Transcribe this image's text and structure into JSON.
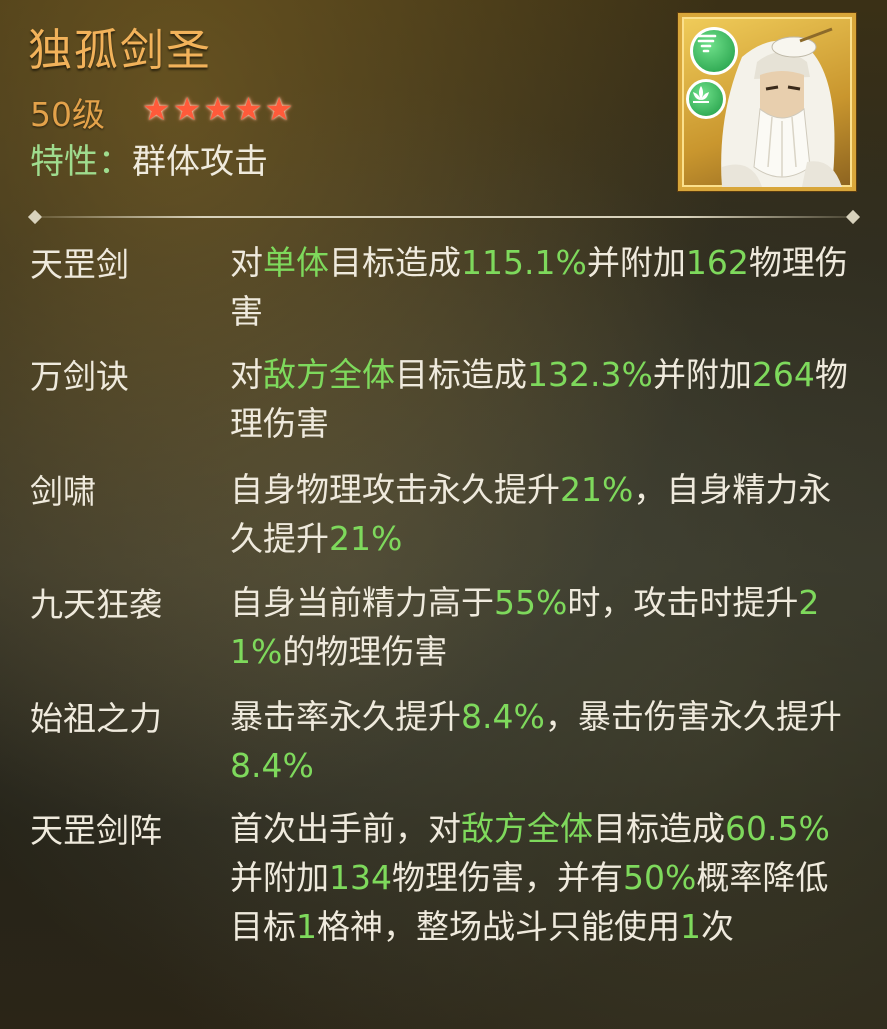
{
  "hero": {
    "name": "独孤剑圣",
    "level": "50级",
    "stars": [
      "★",
      "★",
      "★",
      "★",
      "★"
    ],
    "trait_label": "特性：",
    "trait_value": "群体攻击"
  },
  "portrait": {
    "element_icons": [
      "whirlwind-icon",
      "lotus-icon"
    ],
    "frame_color": "#d8a63a"
  },
  "colors": {
    "name": "#f2b25a",
    "level": "#e3a24a",
    "star": "#ff5a3a",
    "highlight": "#7ed95c",
    "trait_label": "#9fdc8e",
    "text": "#efeadd"
  },
  "skills": [
    {
      "name": "天罡剑",
      "desc": [
        {
          "t": "对",
          "h": false
        },
        {
          "t": "单体",
          "h": true
        },
        {
          "t": "目标造成",
          "h": false
        },
        {
          "t": "115.1%",
          "h": true
        },
        {
          "t": "并附加",
          "h": false
        },
        {
          "t": "162",
          "h": true
        },
        {
          "t": "物理伤害",
          "h": false
        }
      ]
    },
    {
      "name": "万剑诀",
      "desc": [
        {
          "t": "对",
          "h": false
        },
        {
          "t": "敌方全体",
          "h": true
        },
        {
          "t": "目标造成",
          "h": false
        },
        {
          "t": "132.3%",
          "h": true
        },
        {
          "t": "并附加",
          "h": false
        },
        {
          "t": "264",
          "h": true
        },
        {
          "t": "物理伤害",
          "h": false
        }
      ]
    },
    {
      "name": "剑啸",
      "desc": [
        {
          "t": "自身物理攻击永久提升",
          "h": false
        },
        {
          "t": "21%",
          "h": true
        },
        {
          "t": "，自身精力永久提升",
          "h": false
        },
        {
          "t": "21%",
          "h": true
        }
      ]
    },
    {
      "name": "九天狂袭",
      "desc": [
        {
          "t": "自身当前精力高于",
          "h": false
        },
        {
          "t": "55%",
          "h": true
        },
        {
          "t": "时，攻击时提升",
          "h": false
        },
        {
          "t": "21%",
          "h": true
        },
        {
          "t": "的物理伤害",
          "h": false
        }
      ]
    },
    {
      "name": "始祖之力",
      "desc": [
        {
          "t": "暴击率永久提升",
          "h": false
        },
        {
          "t": "8.4%",
          "h": true
        },
        {
          "t": "，暴击伤害永久提升",
          "h": false
        },
        {
          "t": "8.4%",
          "h": true
        }
      ]
    },
    {
      "name": "天罡剑阵",
      "desc": [
        {
          "t": "首次出手前，对",
          "h": false
        },
        {
          "t": "敌方全体",
          "h": true
        },
        {
          "t": "目标造成",
          "h": false
        },
        {
          "t": "60.5%",
          "h": true
        },
        {
          "t": "并附加",
          "h": false
        },
        {
          "t": "134",
          "h": true
        },
        {
          "t": "物理伤害，并有",
          "h": false
        },
        {
          "t": "50%",
          "h": true
        },
        {
          "t": "概率降低目标",
          "h": false
        },
        {
          "t": "1",
          "h": true
        },
        {
          "t": "格神，整场战斗只能使用",
          "h": false
        },
        {
          "t": "1",
          "h": true
        },
        {
          "t": "次",
          "h": false
        }
      ]
    }
  ]
}
